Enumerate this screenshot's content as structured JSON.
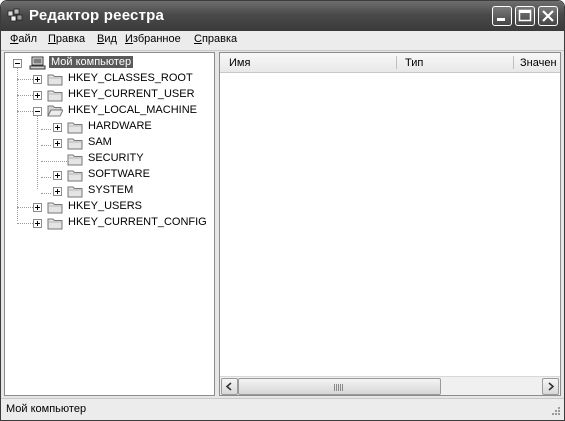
{
  "window": {
    "title": "Редактор реестра"
  },
  "menu": [
    {
      "label": "Файл",
      "underline": "Ф",
      "rest": "айл"
    },
    {
      "label": "Правка",
      "underline": "П",
      "rest": "равка"
    },
    {
      "label": "Вид",
      "underline": "В",
      "rest": "ид"
    },
    {
      "label": "Избранное",
      "underline": "И",
      "rest": "збранное"
    },
    {
      "label": "Справка",
      "underline": "С",
      "rest": "правка"
    }
  ],
  "tree": {
    "root": {
      "label": "Мой компьютер",
      "selected": true,
      "icon": "computer-icon"
    },
    "hkcr": "HKEY_CLASSES_ROOT",
    "hkcu": "HKEY_CURRENT_USER",
    "hklm": "HKEY_LOCAL_MACHINE",
    "hklm_children": {
      "hardware": "HARDWARE",
      "sam": "SAM",
      "security": "SECURITY",
      "software": "SOFTWARE",
      "system": "SYSTEM"
    },
    "hku": "HKEY_USERS",
    "hkcc": "HKEY_CURRENT_CONFIG"
  },
  "list": {
    "columns": {
      "name": "Имя",
      "type": "Тип",
      "value": "Значен"
    }
  },
  "statusbar": {
    "text": "Мой компьютер"
  }
}
